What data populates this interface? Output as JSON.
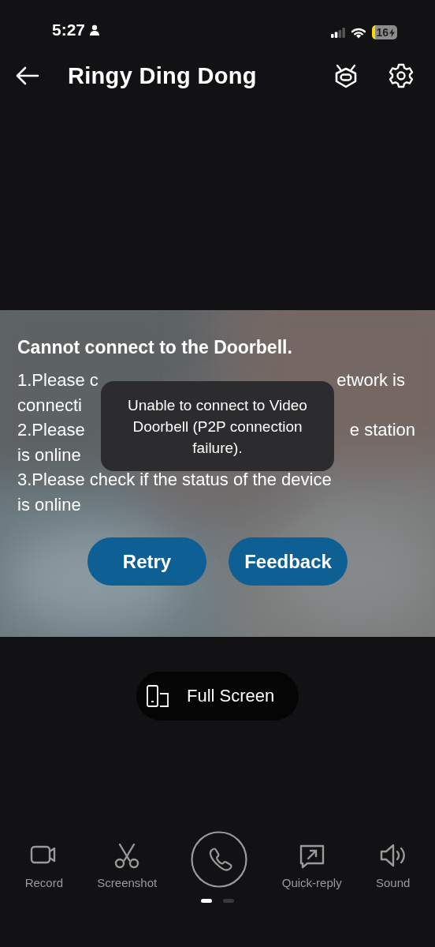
{
  "status_bar": {
    "time": "5:27",
    "battery": "16"
  },
  "header": {
    "title": "Ringy Ding Dong"
  },
  "error_panel": {
    "kind": "picture",
    "title": "Cannot connect to the Doorbell.",
    "lines": [
      {
        "left": "1.Please c",
        "right": "etwork is"
      },
      {
        "left": "connecti"
      },
      {
        "left": "2.Please",
        "right": "e station"
      },
      {
        "left": "is online"
      },
      {
        "left": "3.Please check if the status of the device"
      },
      {
        "left": "is online"
      }
    ],
    "buttons": [
      "Retry",
      "Feedback"
    ],
    "toast": "Unable to connect to Video Doorbell (P2P connection failure)."
  },
  "full_screen": {
    "label": "Full Screen"
  },
  "actions": [
    {
      "kind": "record",
      "label": "Record"
    },
    {
      "kind": "screenshot",
      "label": "Screenshot"
    },
    {
      "kind": "call"
    },
    {
      "kind": "quick-reply",
      "label": "Quick-reply"
    },
    {
      "kind": "sound",
      "label": "Sound"
    }
  ],
  "pages": [
    {
      "selected": true
    },
    {
      "selected": false
    }
  ]
}
